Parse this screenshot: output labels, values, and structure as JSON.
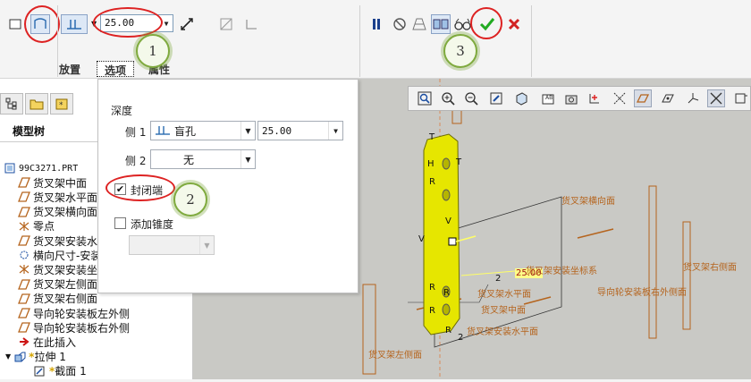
{
  "dashboard": {
    "depth_value": "25.00",
    "tabs": [
      "放置",
      "选项",
      "属性"
    ],
    "active_tab": "选项"
  },
  "callouts": [
    "1",
    "2",
    "3"
  ],
  "left_panel": {
    "title": "模型树",
    "tree": [
      {
        "label": "99C3271.PRT",
        "icon": "part-icon"
      },
      {
        "label": "货叉架中面",
        "icon": "datum-plane-icon"
      },
      {
        "label": "货叉架水平面",
        "icon": "datum-plane-icon"
      },
      {
        "label": "货叉架横向面",
        "icon": "datum-plane-icon"
      },
      {
        "label": "零点",
        "icon": "csys-icon"
      },
      {
        "label": "货叉架安装水",
        "icon": "datum-plane-icon"
      },
      {
        "label": "横向尺寸-安装",
        "icon": "datum-axis-icon"
      },
      {
        "label": "货叉架安装坐",
        "icon": "csys-icon"
      },
      {
        "label": "货叉架左侧面",
        "icon": "datum-plane-icon"
      },
      {
        "label": "货叉架右侧面",
        "icon": "datum-plane-icon"
      },
      {
        "label": "导向轮安装板左外侧",
        "icon": "datum-plane-icon"
      },
      {
        "label": "导向轮安装板右外侧",
        "icon": "datum-plane-icon"
      },
      {
        "label": "在此插入",
        "icon": "insert-arrow-icon"
      },
      {
        "label": "拉伸 1",
        "icon": "extrude-icon"
      },
      {
        "label": "截面 1",
        "icon": "sketch-icon"
      }
    ]
  },
  "options_panel": {
    "depth_label": "深度",
    "side1_label": "侧 1",
    "side1_option": "盲孔",
    "side1_value": "25.00",
    "side2_label": "侧 2",
    "side2_option": "无",
    "capped_ends_label": "封闭端",
    "capped_ends_checked": true,
    "taper_label": "添加锥度",
    "taper_checked": false
  },
  "graphics": {
    "dimension_value": "25.00",
    "datum_labels": [
      "货叉架横向面",
      "货叉架安装坐标系",
      "货叉架右侧面",
      "货叉架水平面",
      "导向轮安装板右外侧面",
      "货叉架中面",
      "货叉架安装水平面",
      "货叉架左侧面"
    ],
    "markers": [
      "T",
      "T",
      "H",
      "R",
      "V",
      "V",
      "R",
      "R",
      "R",
      "R",
      "2",
      "2"
    ]
  },
  "colors": {
    "part_yellow": "#e6e600",
    "datum_orange": "#b5641d",
    "callout_green": "#7faa3e",
    "highlight_red": "#d22222",
    "ok_green": "#22aa22"
  }
}
